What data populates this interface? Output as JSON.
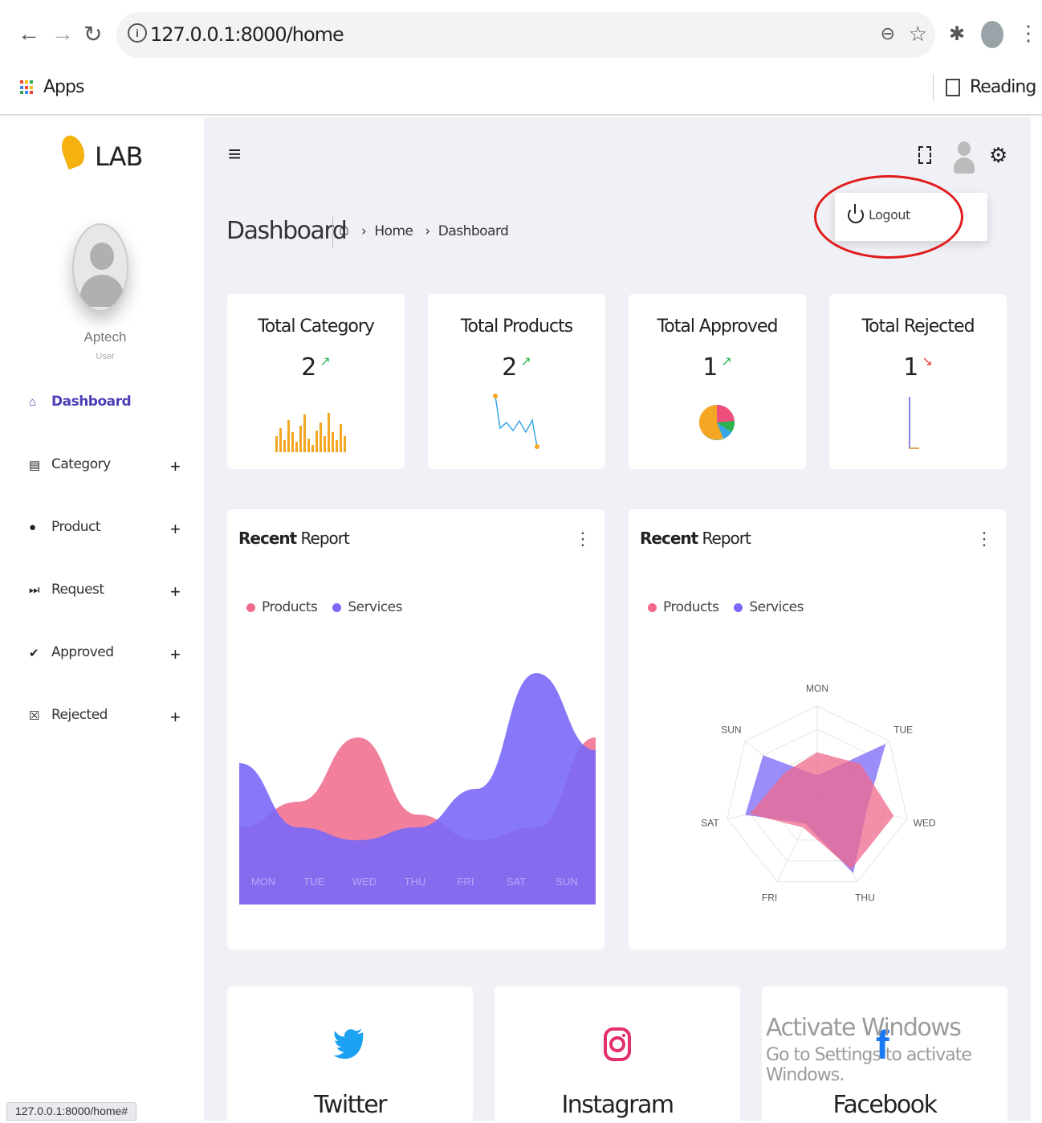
{
  "browser": {
    "url": "127.0.0.1:8000/home",
    "bookmarks_apps": "Apps",
    "reading_list": "Reading list",
    "status_url": "127.0.0.1:8000/home#"
  },
  "sidebar": {
    "brand": "LAB",
    "user_name": "Aptech",
    "user_role": "User",
    "items": [
      {
        "label": "Dashboard",
        "icon": "home-icon",
        "active": true
      },
      {
        "label": "Category",
        "icon": "list-icon",
        "expandable": "+"
      },
      {
        "label": "Product",
        "icon": "product-icon",
        "expandable": "+"
      },
      {
        "label": "Request",
        "icon": "fast-forward-icon",
        "expandable": "+"
      },
      {
        "label": "Approved",
        "icon": "check-circle-icon",
        "expandable": "+"
      },
      {
        "label": "Rejected",
        "icon": "x-square-icon",
        "expandable": "+"
      }
    ]
  },
  "header": {
    "page_title": "Dashboard",
    "breadcrumb": [
      "Home",
      "Dashboard"
    ],
    "dropdown_logout": "Logout"
  },
  "stats": [
    {
      "title": "Total Category",
      "value": "2",
      "trend": "up"
    },
    {
      "title": "Total Products",
      "value": "2",
      "trend": "up"
    },
    {
      "title": "Total Approved",
      "value": "1",
      "trend": "up"
    },
    {
      "title": "Total Rejected",
      "value": "1",
      "trend": "down"
    }
  ],
  "reports": [
    {
      "title_bold": "Recent",
      "title_rest": "Report",
      "legend": [
        "Products",
        "Services"
      ]
    },
    {
      "title_bold": "Recent",
      "title_rest": "Report",
      "legend": [
        "Products",
        "Services"
      ]
    }
  ],
  "colors": {
    "accent": "#4a3fb5",
    "products": "#f06a8c",
    "services": "#7a68f8",
    "bars": "#f5a623"
  },
  "chart_data": [
    {
      "type": "area",
      "categories": [
        "MON",
        "TUE",
        "WED",
        "THU",
        "FRI",
        "SAT",
        "SUN"
      ],
      "series": [
        {
          "name": "Products",
          "values": [
            30,
            40,
            65,
            35,
            25,
            30,
            65
          ]
        },
        {
          "name": "Services",
          "values": [
            55,
            30,
            25,
            30,
            45,
            90,
            60
          ]
        }
      ]
    },
    {
      "type": "radar",
      "categories": [
        "MON",
        "TUE",
        "WED",
        "THU",
        "FRI",
        "SAT",
        "SUN"
      ],
      "series": [
        {
          "name": "Products",
          "values": [
            50,
            60,
            85,
            85,
            35,
            75,
            45
          ]
        },
        {
          "name": "Services",
          "values": [
            25,
            95,
            55,
            90,
            30,
            80,
            75
          ]
        }
      ]
    }
  ],
  "social": [
    "Twitter",
    "Instagram",
    "Facebook"
  ],
  "watermark": {
    "line1": "Activate Windows",
    "line2": "Go to Settings to activate Windows."
  }
}
